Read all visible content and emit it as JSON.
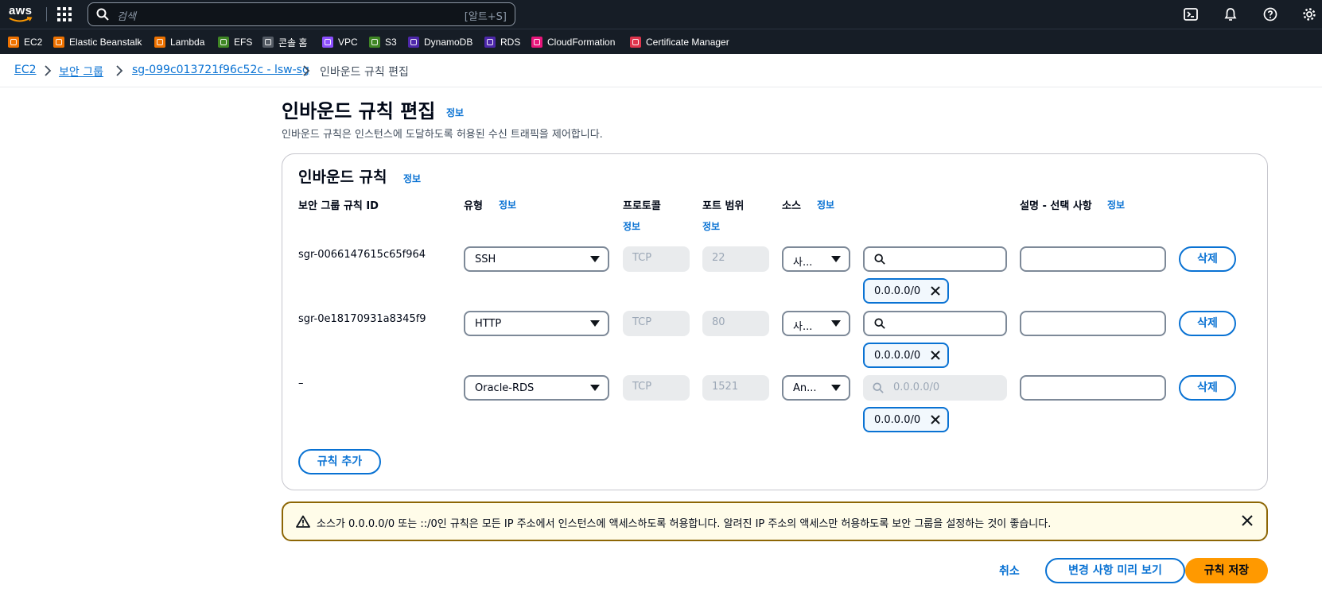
{
  "topbar": {
    "logo_text": "aws",
    "search_placeholder": "검색",
    "search_shortcut": "[알트+S]",
    "icons": [
      "apps-grid-icon",
      "search-icon",
      "cloudshell-icon",
      "bell-icon",
      "help-icon",
      "gear-icon"
    ]
  },
  "favorites": [
    {
      "label": "EC2",
      "color": "#ed7100"
    },
    {
      "label": "Elastic Beanstalk",
      "color": "#ed7100"
    },
    {
      "label": "Lambda",
      "color": "#ed7100"
    },
    {
      "label": "EFS",
      "color": "#3f8624"
    },
    {
      "label": "콘솔 홈",
      "color": "#545b64"
    },
    {
      "label": "VPC",
      "color": "#8c4fff"
    },
    {
      "label": "S3",
      "color": "#3f8624"
    },
    {
      "label": "DynamoDB",
      "color": "#4d27aa"
    },
    {
      "label": "RDS",
      "color": "#4d27aa"
    },
    {
      "label": "CloudFormation",
      "color": "#e7157b"
    },
    {
      "label": "Certificate Manager",
      "color": "#dd344c"
    }
  ],
  "breadcrumb": {
    "items": [
      "EC2",
      "보안 그룹",
      "sg-099c013721f96c52c - lsw-sg",
      "인바운드 규칙 편집"
    ]
  },
  "header": {
    "title": "인바운드 규칙 편집",
    "info": "정보",
    "description": "인바운드 규칙은 인스턴스에 도달하도록 허용된 수신 트래픽을 제어합니다."
  },
  "rules_panel": {
    "title": "인바운드 규칙",
    "info": "정보",
    "columns": {
      "rule_id": "보안 그룹 규칙 ID",
      "type": "유형",
      "protocol": "프로토콜",
      "port_range": "포트 범위",
      "source": "소스",
      "description": "설명 - 선택 사항",
      "info": "정보"
    },
    "rows": [
      {
        "id": "sgr-0066147615c65f964",
        "type": "SSH",
        "protocol": "TCP",
        "port": "22",
        "source_type": "사...",
        "source_search": "",
        "token": "0.0.0.0/0",
        "delete": "삭제"
      },
      {
        "id": "sgr-0e18170931a8345f9",
        "type": "HTTP",
        "protocol": "TCP",
        "port": "80",
        "source_type": "사...",
        "source_search": "",
        "token": "0.0.0.0/0",
        "delete": "삭제"
      },
      {
        "id": "–",
        "type": "Oracle-RDS",
        "protocol": "TCP",
        "port": "1521",
        "source_type": "An...",
        "source_search": "0.0.0.0/0",
        "token": "0.0.0.0/0",
        "delete": "삭제"
      }
    ],
    "add_rule": "규칙 추가"
  },
  "alert": {
    "message": "소스가 0.0.0.0/0 또는 ::/0인 규칙은 모든 IP 주소에서 인스턴스에 액세스하도록 허용합니다. 알려진 IP 주소의 액세스만 허용하도록 보안 그룹을 설정하는 것이 좋습니다.",
    "border_color": "#8d6605"
  },
  "footer": {
    "cancel": "취소",
    "preview": "변경 사항 미리 보기",
    "save": "규칙 저장"
  },
  "colors": {
    "accent": "#0972d3",
    "primary_button": "#ff9900",
    "topbar": "#161d26"
  }
}
